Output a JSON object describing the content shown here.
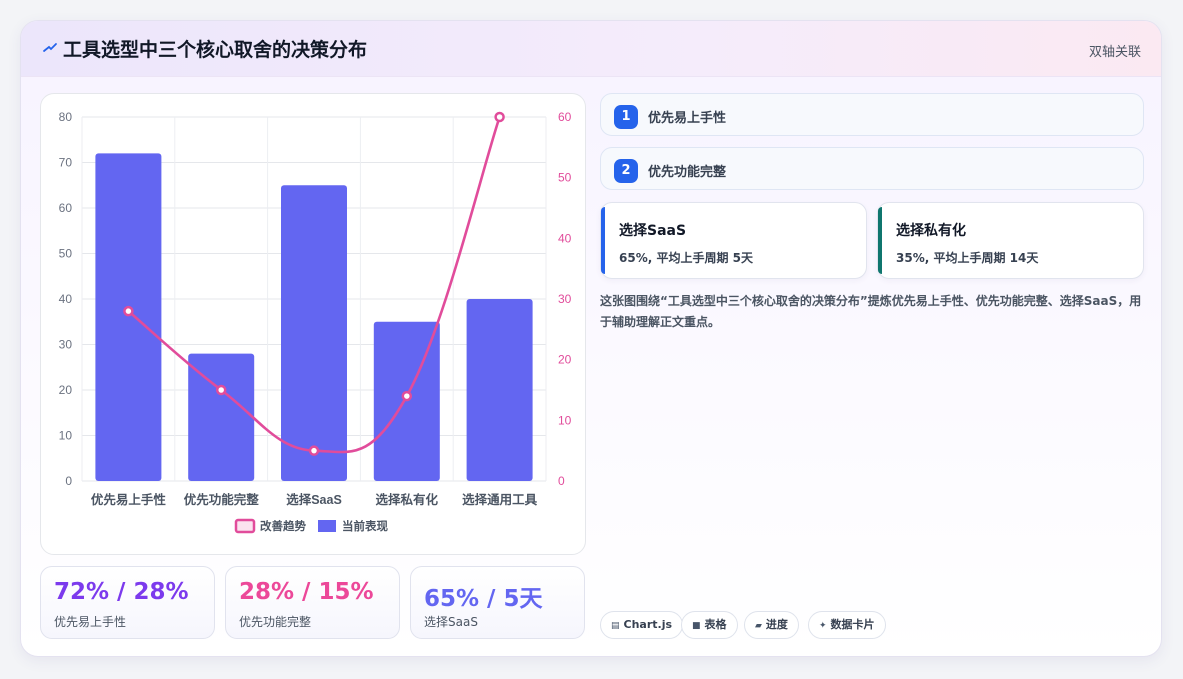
{
  "header": {
    "title": "工具选型中三个核心取舍的决策分布",
    "mode_label": "双轴关联"
  },
  "steps": [
    {
      "num": "1",
      "label": "优先易上手性"
    },
    {
      "num": "2",
      "label": "优先功能完整"
    }
  ],
  "options": [
    {
      "name": "选择SaaS",
      "desc": "65%, 平均上手周期 5天",
      "color": "#2563eb"
    },
    {
      "name": "选择私有化",
      "desc": "35%, 平均上手周期 14天",
      "color": "#0f766e"
    }
  ],
  "summary": "这张图围绕“工具选型中三个核心取舍的决策分布”提炼优先易上手性、优先功能完整、选择SaaS，用于辅助理解正文重点。",
  "stats": [
    {
      "value": "72% / 28%",
      "label": "优先易上手性",
      "color": "#7c3aed"
    },
    {
      "value": "28% / 15%",
      "label": "优先功能完整",
      "color": "#ec4899"
    },
    {
      "value": "65% / 5天",
      "label": "选择SaaS",
      "color": "#6366f1"
    }
  ],
  "tags": [
    {
      "icon": "chart-icon",
      "glyph": "▤",
      "label": "Chart.js"
    },
    {
      "icon": "table-icon",
      "glyph": "■",
      "label": "表格"
    },
    {
      "icon": "progress-icon",
      "glyph": "▰",
      "label": "进度"
    },
    {
      "icon": "card-icon",
      "glyph": "✦",
      "label": "数据卡片"
    }
  ],
  "chart_data": {
    "type": "bar",
    "categories": [
      "优先易上手性",
      "优先功能完整",
      "选择SaaS",
      "选择私有化",
      "选择通用工具"
    ],
    "series": [
      {
        "name": "当前表现",
        "type": "bar",
        "axis": "left",
        "values": [
          72,
          28,
          65,
          35,
          40
        ],
        "color": "#6366f1"
      },
      {
        "name": "改善趋势",
        "type": "line",
        "axis": "right",
        "values": [
          28,
          15,
          5,
          14,
          60
        ],
        "color": "#e14c9b"
      }
    ],
    "ylim_left": [
      0,
      80
    ],
    "yticks_left": [
      0,
      10,
      20,
      30,
      40,
      50,
      60,
      70,
      80
    ],
    "ylim_right": [
      0,
      60
    ],
    "yticks_right": [
      0,
      10,
      20,
      30,
      40,
      50,
      60
    ],
    "legend": [
      "改善趋势",
      "当前表现"
    ],
    "legend_position": "bottom",
    "grid": true
  }
}
